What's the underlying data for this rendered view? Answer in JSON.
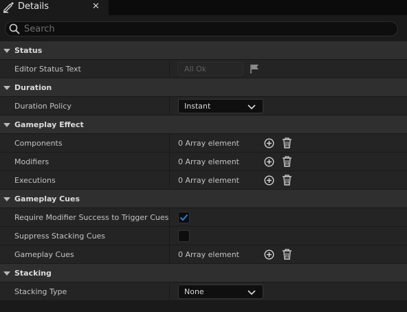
{
  "tab": {
    "title": "Details",
    "close": "✕"
  },
  "search": {
    "placeholder": "Search"
  },
  "categories": [
    {
      "label": "Status"
    },
    {
      "label": "Duration"
    },
    {
      "label": "Gameplay Effect"
    },
    {
      "label": "Gameplay Cues"
    },
    {
      "label": "Stacking"
    }
  ],
  "status": {
    "editor_status_label": "Editor Status Text",
    "editor_status_value": "All Ok"
  },
  "duration": {
    "policy_label": "Duration Policy",
    "policy_value": "Instant"
  },
  "gameplay_effect": {
    "components_label": "Components",
    "components_value": "0 Array element",
    "modifiers_label": "Modifiers",
    "modifiers_value": "0 Array element",
    "executions_label": "Executions",
    "executions_value": "0 Array element"
  },
  "gameplay_cues": {
    "require_label": "Require Modifier Success to Trigger Cues",
    "require_checked": true,
    "suppress_label": "Suppress Stacking Cues",
    "suppress_checked": false,
    "cues_label": "Gameplay Cues",
    "cues_value": "0 Array element"
  },
  "stacking": {
    "type_label": "Stacking Type",
    "type_value": "None"
  },
  "colors": {
    "accent": "#2f7fe0",
    "background": "#1a1a1a",
    "category": "#2f2f2f",
    "row": "#242424"
  },
  "icons": [
    "details-icon",
    "search-icon",
    "flag-icon",
    "chevron-down-icon",
    "add-icon",
    "delete-icon",
    "check-icon"
  ]
}
